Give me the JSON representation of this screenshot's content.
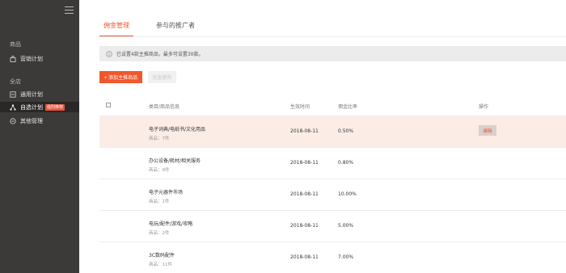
{
  "sidebar": {
    "section_goods": "商品",
    "marketing_plan": "营销计划",
    "section_store": "全店",
    "general_plan": "通用计划",
    "custom_plan": "自选计划",
    "recommended_badge": "强烈推荐",
    "other_manage": "其他管理"
  },
  "tabs": [
    "佣金管理",
    "参与的推广者"
  ],
  "notice": {
    "text": "已设置4款主推商品，最多可设置30款。"
  },
  "toolbar": {
    "add_label": "+ 添加主推商品",
    "batch_label": "批量删除"
  },
  "table": {
    "headers": {
      "category": "类目/商品信息",
      "effective": "生效时间",
      "rate": "佣金比率",
      "action": "操作"
    },
    "edit_label": "编辑",
    "rows": [
      {
        "name": "电子词典/电纸书/文化用品",
        "count": "商品：7件",
        "date": "2018-08-11",
        "rate": "0.50%"
      },
      {
        "name": "办公设备/耗材/相关服务",
        "count": "商品：9件",
        "date": "2018-08-11",
        "rate": "0.80%"
      },
      {
        "name": "电子元器件市场",
        "count": "商品：1件",
        "date": "2018-08-11",
        "rate": "10.00%"
      },
      {
        "name": "电玩/配件/游戏/攻略",
        "count": "商品：2件",
        "date": "2018-08-11",
        "rate": "5.00%"
      },
      {
        "name": "3C数码配件",
        "count": "商品：11件",
        "date": "2018-08-11",
        "rate": "7.00%"
      }
    ]
  },
  "colors": {
    "accent": "#f0582c",
    "sidebar": "#3c3a38",
    "highlight_row": "#fbece6"
  }
}
